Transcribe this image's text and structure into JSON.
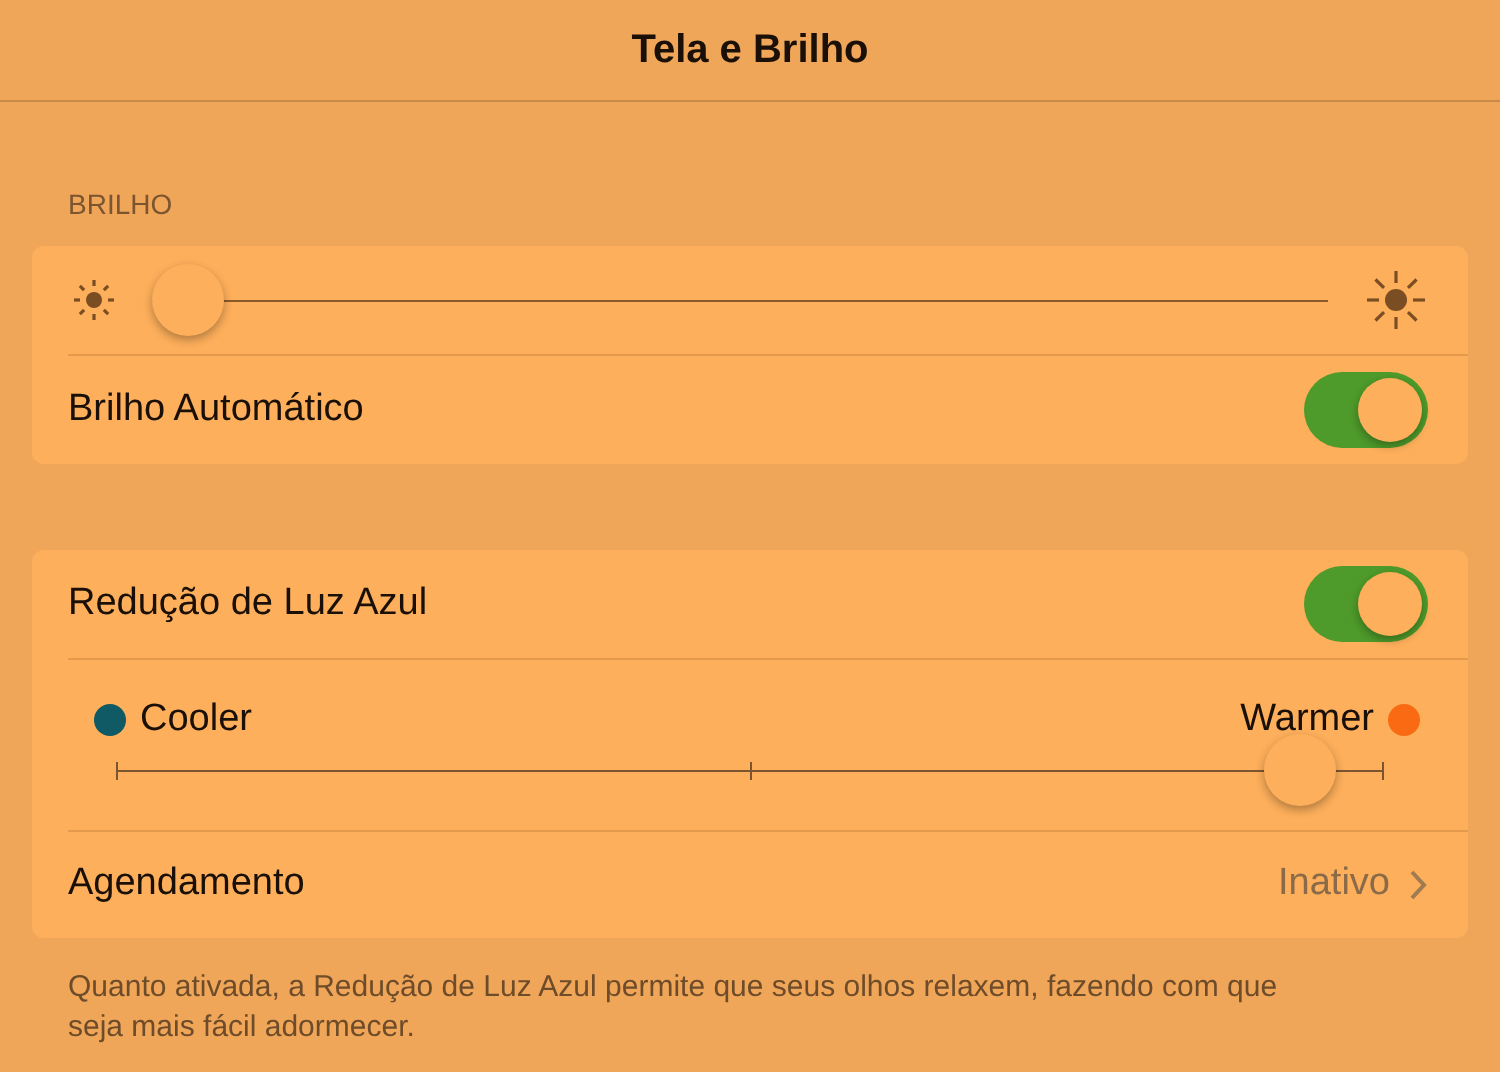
{
  "header": {
    "title": "Tela e Brilho"
  },
  "brightness": {
    "section_label": "BRILHO",
    "level": 0.0,
    "auto": {
      "label": "Brilho Automático",
      "on": true
    }
  },
  "night_shift": {
    "toggle": {
      "label": "Redução de Luz Azul",
      "on": true
    },
    "ends": [
      {
        "label": "Cooler",
        "color": "#105a66"
      },
      {
        "label": "Warmer",
        "color": "#f96a12"
      }
    ],
    "level": 0.96,
    "schedule": {
      "label": "Agendamento",
      "value": "Inativo"
    },
    "footer": "Quanto ativada, a Redução de Luz Azul permite que seus olhos relaxem, fazendo com que seja mais fácil adormecer."
  }
}
